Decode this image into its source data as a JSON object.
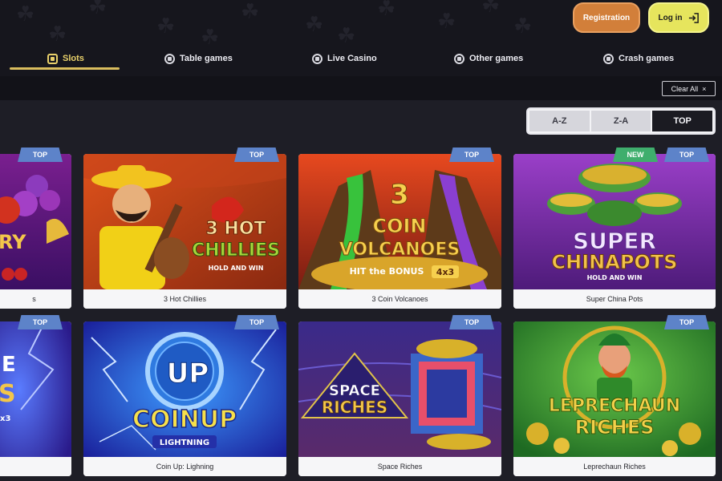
{
  "header": {
    "register_label": "Registration",
    "login_label": "Log in"
  },
  "categories": [
    {
      "label": "Slots",
      "icon": "slots-icon",
      "active": true
    },
    {
      "label": "Table games",
      "icon": "table-games-icon"
    },
    {
      "label": "Live Casino",
      "icon": "live-casino-icon"
    },
    {
      "label": "Other games",
      "icon": "other-games-icon"
    },
    {
      "label": "Crash games",
      "icon": "crash-games-icon"
    }
  ],
  "filters": {
    "clear_all_label": "Clear All",
    "clear_icon": "×"
  },
  "sort": {
    "options": [
      "A-Z",
      "Z-A",
      "TOP"
    ],
    "selected": "TOP"
  },
  "games": [
    {
      "name": "s",
      "badges": [
        "TOP"
      ]
    },
    {
      "name": "3 Hot Chillies",
      "badges": [
        "TOP"
      ],
      "art_title": "3 HOT",
      "art_title2": "CHILLIES",
      "art_sub": "HOLD AND WIN"
    },
    {
      "name": "3 Coin Volcanoes",
      "badges": [
        "TOP"
      ],
      "art_title": "3",
      "art_title2": "COIN",
      "art_title3": "VOLCANOES",
      "art_sub": "HIT the BONUS",
      "art_sub2": "4x3"
    },
    {
      "name": "Super China Pots",
      "badges": [
        "NEW",
        "TOP"
      ],
      "art_title": "SUPER",
      "art_title2": "CHINAPOTS",
      "art_sub": "HOLD AND WIN"
    },
    {
      "name": "",
      "badges": [
        "TOP"
      ]
    },
    {
      "name": "Coin Up: Lighning",
      "badges": [
        "TOP"
      ],
      "art_title": "UP",
      "art_title2": "COINUP",
      "art_sub": "LIGHTNING"
    },
    {
      "name": "Space Riches",
      "badges": [
        "TOP"
      ],
      "art_title": "SPACE",
      "art_title2": "RICHES"
    },
    {
      "name": "Leprechaun Riches",
      "badges": [
        "TOP"
      ],
      "art_title": "LEPRECHAUN",
      "art_title2": "RICHES"
    }
  ],
  "colors": {
    "background": "#1e1e26",
    "accent_active": "#e8d06a",
    "register": "#d27f3a",
    "login": "#e6e55d",
    "badge_top": "#5d83c9",
    "badge_new": "#3fae6d"
  }
}
